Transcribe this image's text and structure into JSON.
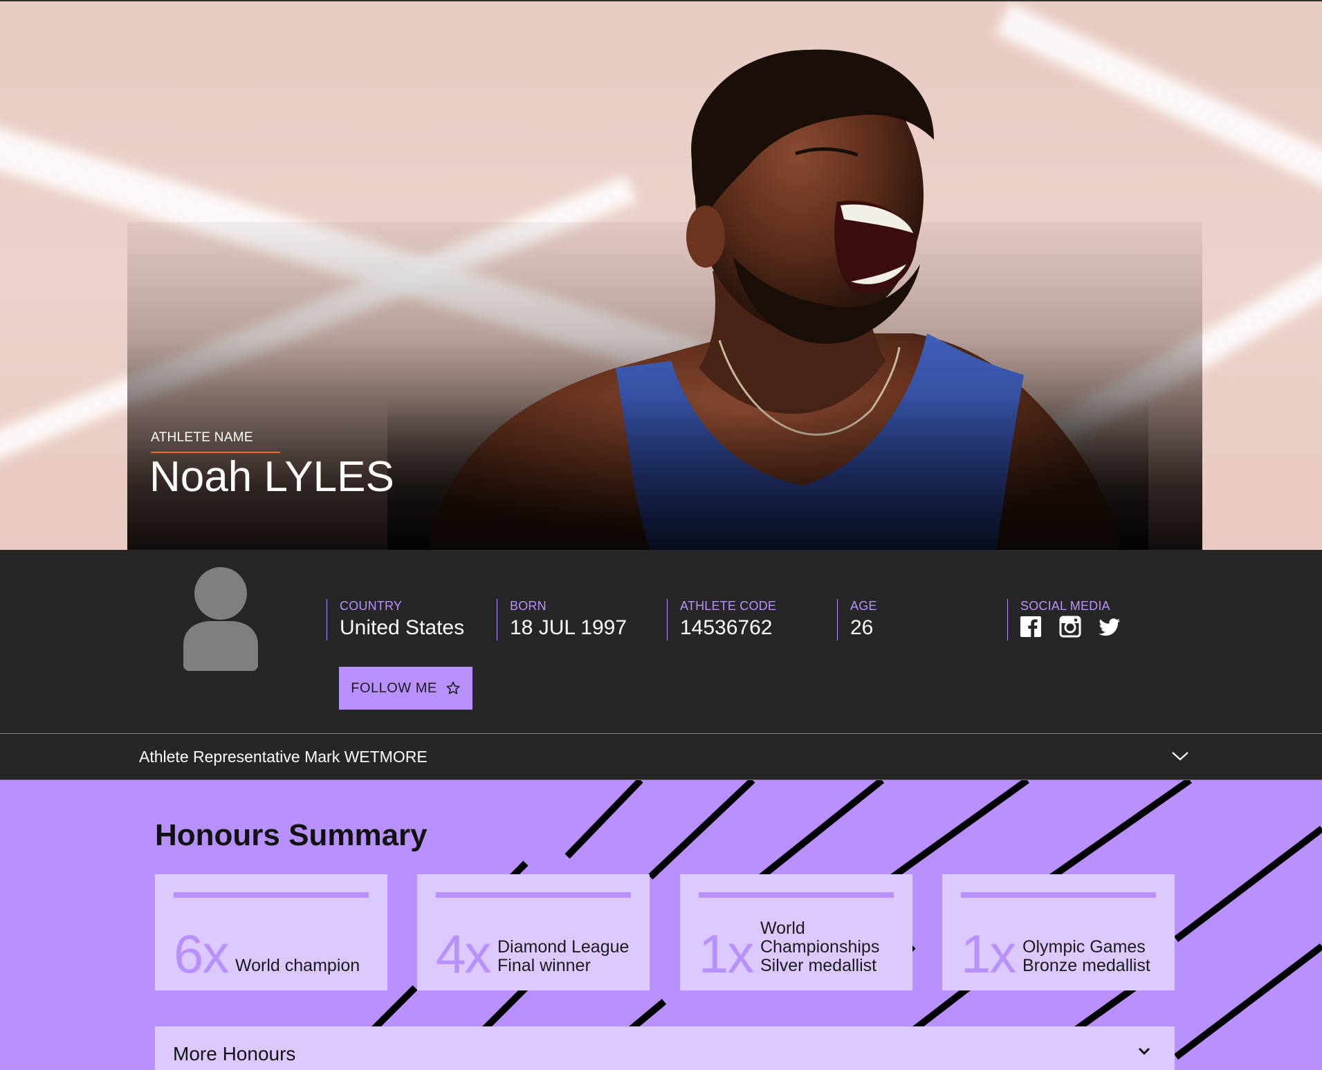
{
  "hero": {
    "name_label": "ATHLETE NAME",
    "athlete_name": "Noah LYLES"
  },
  "info": {
    "fields": [
      {
        "label": "COUNTRY",
        "value": "United States"
      },
      {
        "label": "BORN",
        "value": "18 JUL 1997"
      },
      {
        "label": "ATHLETE CODE",
        "value": "14536762"
      },
      {
        "label": "AGE",
        "value": "26"
      }
    ],
    "social_label": "SOCIAL MEDIA",
    "social_icons": [
      "facebook-icon",
      "instagram-icon",
      "twitter-icon"
    ],
    "follow_label": "FOLLOW ME"
  },
  "representative": {
    "text": "Athlete Representative Mark WETMORE"
  },
  "honours": {
    "title": "Honours Summary",
    "cards": [
      {
        "count": "6x",
        "desc_lines": [
          "World champion"
        ]
      },
      {
        "count": "4x",
        "desc_lines": [
          "Diamond League",
          "Final winner"
        ]
      },
      {
        "count": "1x",
        "desc_lines": [
          "World",
          "Championships",
          "Silver medallist"
        ]
      },
      {
        "count": "1x",
        "desc_lines": [
          "Olympic Games",
          "Bronze medallist"
        ]
      }
    ],
    "more_label": "More Honours"
  },
  "colors": {
    "accent": "#b991ff",
    "accent_light": "#dcc9ff",
    "dark_bg": "#262626",
    "name_rule": "#e46d2a"
  }
}
